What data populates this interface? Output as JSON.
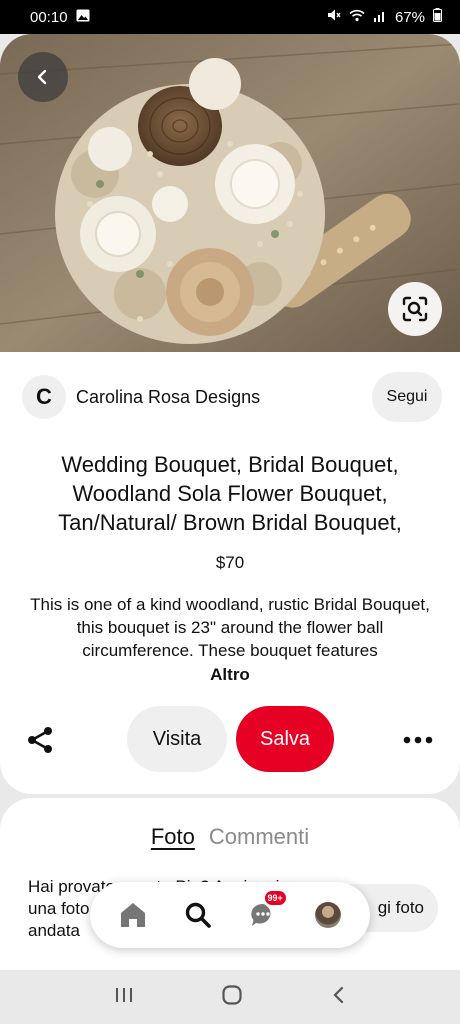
{
  "status_bar": {
    "time": "00:10",
    "battery": "67%",
    "icons": [
      "gallery-icon",
      "mute-icon",
      "wifi-icon",
      "signal-icon",
      "battery-icon"
    ]
  },
  "pin": {
    "image_subject": "",
    "creator": {
      "initial": "C",
      "name": "Carolina Rosa Designs",
      "follow_label": "Segui"
    },
    "title": "Wedding Bouquet, Bridal Bouquet, Woodland Sola Flower Bouquet, Tan/Natural/ Brown Bridal Bouquet,",
    "price": "$70",
    "description": "This is one of a kind woodland, rustic Bridal Bouquet, this bouquet is 23\" around the flower ball circumference. These bouquet features",
    "more_label": "Altro",
    "actions": {
      "visit_label": "Visita",
      "save_label": "Salva"
    },
    "colors": {
      "save": "#e60023",
      "pill": "#efefef"
    }
  },
  "comments": {
    "tabs": [
      {
        "label": "Foto",
        "active": true
      },
      {
        "label": "Commenti",
        "active": false
      }
    ],
    "text": "Hai provato questo Pin? Aggiungi una foto per far vedere com'è andata",
    "text_visible": "Hai provi  ... Aggiun  ... vedere c",
    "add_photo_label": "gi foto"
  },
  "tab_bar": {
    "items": [
      "home-icon",
      "search-icon",
      "messages-icon",
      "profile-avatar"
    ],
    "badge": "99+"
  },
  "nav_bar": {
    "items": [
      "recents-icon",
      "home-nav-icon",
      "back-nav-icon"
    ]
  }
}
